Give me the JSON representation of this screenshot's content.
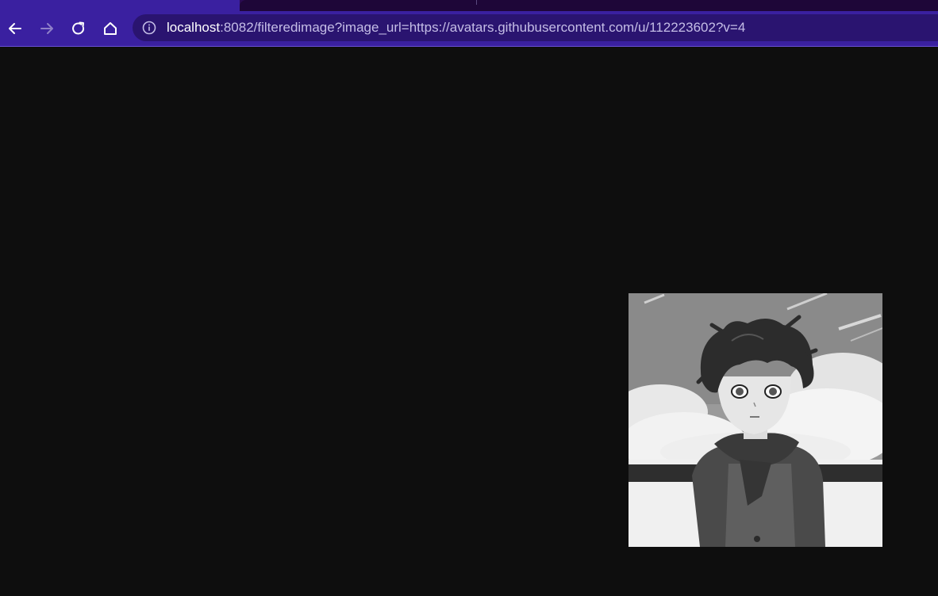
{
  "browser": {
    "url": {
      "host": "localhost",
      "rest": ":8082/filteredimage?image_url=https://avatars.githubusercontent.com/u/112223602?v=4"
    },
    "icons": [
      "back-arrow-icon",
      "forward-arrow-icon",
      "reload-icon",
      "home-icon",
      "info-icon"
    ],
    "colors": {
      "toolbar": "#3a20a0",
      "omnibox": "#2a1470",
      "page_background": "#0e0e0e"
    }
  },
  "page": {
    "image": {
      "description_icon": "grayscale-anime-avatar"
    }
  }
}
